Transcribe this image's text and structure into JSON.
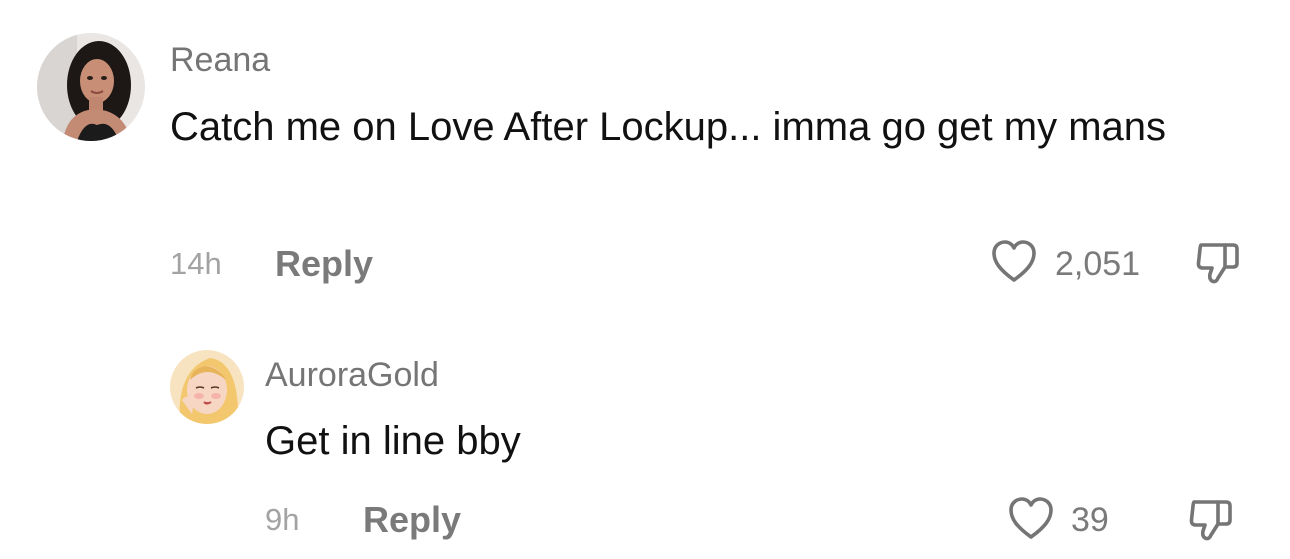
{
  "comments": [
    {
      "username": "Reana",
      "text": "Catch me on Love After Lockup... imma go get my mans",
      "time": "14h",
      "reply_label": "Reply",
      "like_count": "2,051"
    },
    {
      "username": "AuroraGold",
      "text": "Get in line bby",
      "time": "9h",
      "reply_label": "Reply",
      "like_count": "39"
    }
  ],
  "icons": {
    "like": "heart-outline-icon",
    "dislike": "thumbs-down-icon"
  },
  "colors": {
    "username": "#757575",
    "text": "#111111",
    "meta": "#a3a3a3",
    "action": "#7a7a7a"
  }
}
